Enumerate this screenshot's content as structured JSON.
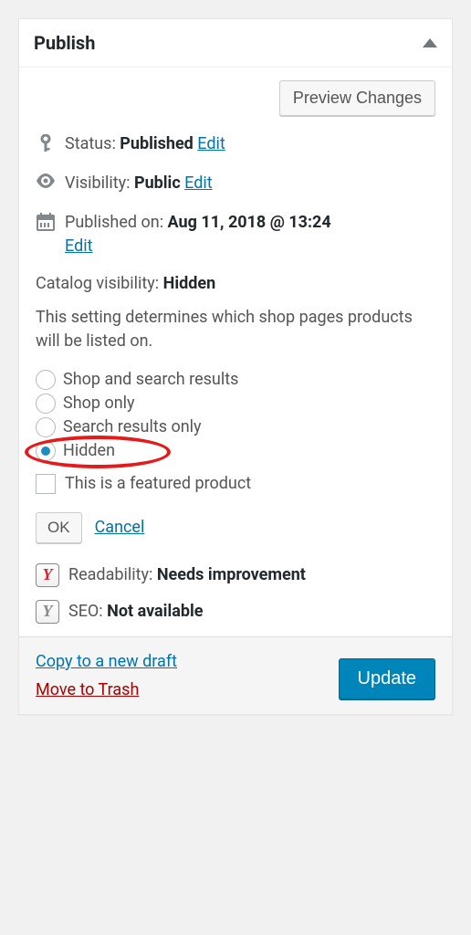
{
  "panel": {
    "title": "Publish",
    "preview_button": "Preview Changes",
    "status": {
      "label": "Status:",
      "value": "Published",
      "edit": "Edit"
    },
    "visibility": {
      "label": "Visibility:",
      "value": "Public",
      "edit": "Edit"
    },
    "published_on": {
      "label": "Published on:",
      "value": "Aug 11, 2018 @ 13:24",
      "edit": "Edit"
    },
    "catalog": {
      "label": "Catalog visibility:",
      "value": "Hidden",
      "description": "This setting determines which shop pages products will be listed on.",
      "options": [
        {
          "label": "Shop and search results",
          "checked": false
        },
        {
          "label": "Shop only",
          "checked": false
        },
        {
          "label": "Search results only",
          "checked": false
        },
        {
          "label": "Hidden",
          "checked": true
        }
      ],
      "featured_label": "This is a featured product",
      "featured_checked": false,
      "ok": "OK",
      "cancel": "Cancel"
    },
    "yoast": {
      "readability_label": "Readability:",
      "readability_value": "Needs improvement",
      "seo_label": "SEO:",
      "seo_value": "Not available"
    },
    "footer": {
      "copy": "Copy to a new draft",
      "trash": "Move to Trash",
      "update": "Update"
    }
  }
}
